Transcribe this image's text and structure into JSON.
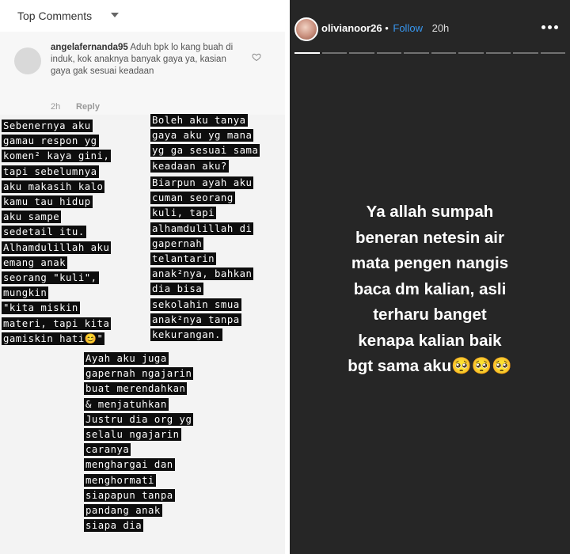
{
  "left_panel": {
    "header": {
      "title": "Top Comments"
    },
    "comment": {
      "username": "angelafernanda95",
      "text": "Aduh bpk lo kang buah di induk,  kok anaknya banyak gaya ya, kasian gaya gak sesuai keadaan",
      "time": "2h",
      "reply_label": "Reply"
    },
    "dm_blocks": [
      {
        "lines": [
          "Sebenernya aku",
          "gamau respon yg",
          "komen² kaya gini,",
          "tapi sebelumnya",
          "aku makasih kalo",
          "kamu tau hidup",
          "aku sampe",
          "sedetail itu.",
          "Alhamdulillah aku",
          "emang anak",
          "seorang \"kuli\",",
          "mungkin",
          "\"kita miskin",
          "materi, tapi kita",
          "gamiskin hati😊\""
        ]
      },
      {
        "lines": [
          "Boleh aku tanya",
          "gaya aku yg mana",
          "yg ga sesuai sama",
          "keadaan aku?"
        ]
      },
      {
        "lines": [
          "Biarpun ayah aku",
          "cuman seorang",
          "kuli, tapi",
          "alhamdulillah di",
          "gapernah",
          "telantarin",
          "anak²nya, bahkan",
          "dia bisa",
          "sekolahin smua",
          "anak²nya tanpa",
          "kekurangan."
        ]
      },
      {
        "lines": [
          "Ayah aku juga",
          "gapernah ngajarin",
          "buat merendahkan",
          "& menjatuhkan",
          "Justru dia org yg",
          "selalu ngajarin",
          "caranya",
          "menghargai dan",
          "menghormati",
          "siapapun tanpa",
          "pandang anak",
          "siapa dia"
        ]
      }
    ]
  },
  "story": {
    "username": "olivianoor26",
    "separator": "•",
    "follow_label": "Follow",
    "time": "20h",
    "progress_segments": 10,
    "progress_done": 1,
    "text_lines": [
      "Ya allah sumpah",
      "beneran netesin air",
      "mata pengen nangis",
      "baca dm kalian, asli",
      "terharu banget",
      "kenapa kalian baik",
      "bgt sama aku🥺🥺🥺"
    ]
  },
  "colors": {
    "story_bg": "#262626",
    "follow": "#3897f0",
    "dm_highlight": "#0d0d0d"
  }
}
